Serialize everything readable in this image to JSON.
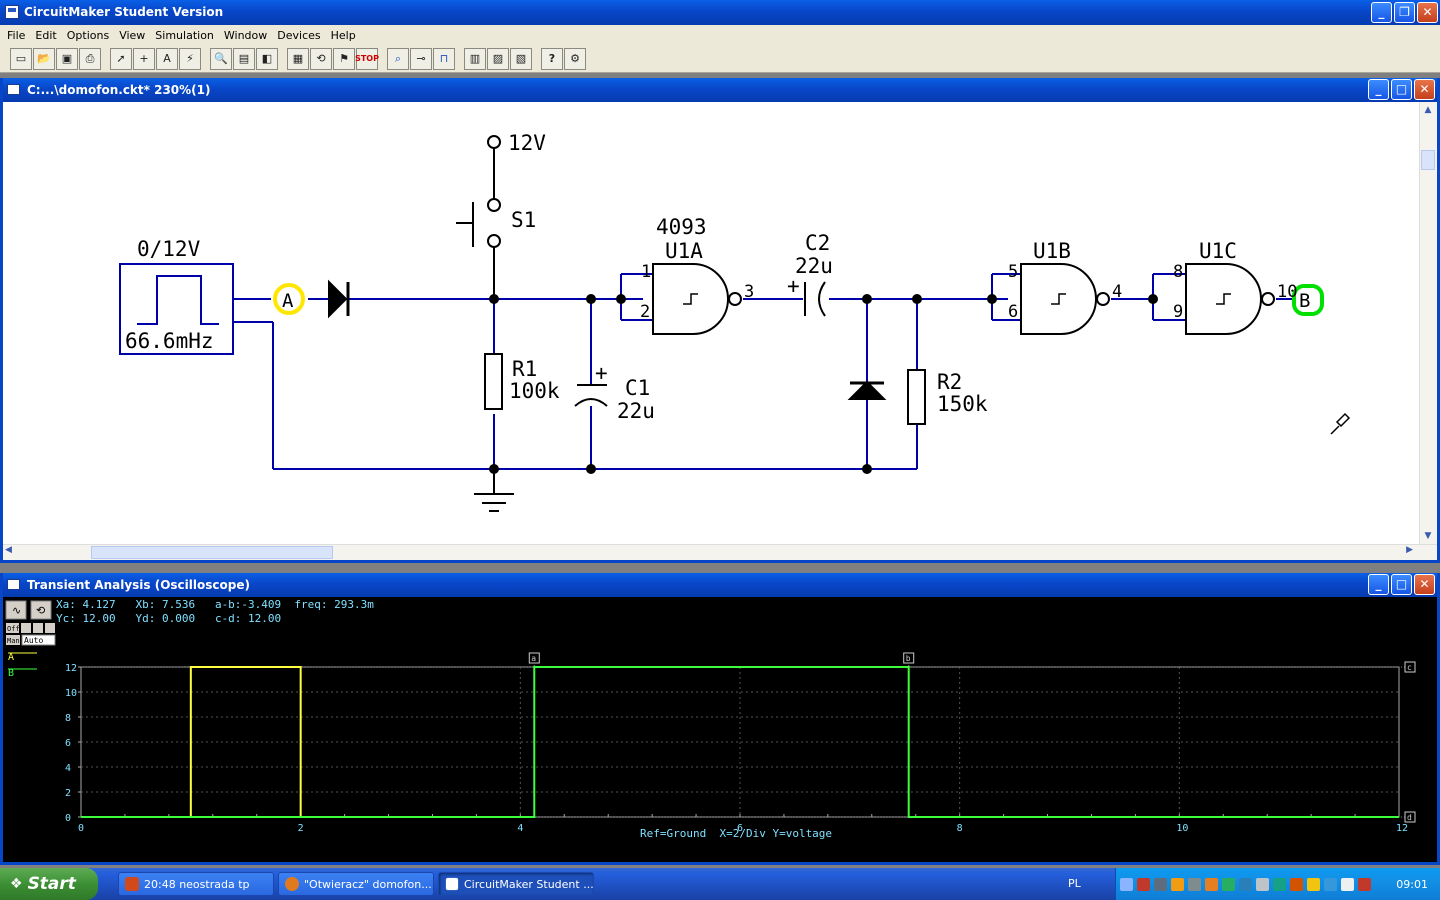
{
  "app": {
    "title": "CircuitMaker Student Version"
  },
  "menu": [
    "File",
    "Edit",
    "Options",
    "View",
    "Simulation",
    "Window",
    "Devices",
    "Help"
  ],
  "schematic_window": {
    "title": "C:...\\domofon.ckt* 230%(1)",
    "labels": {
      "supply": "12V",
      "switch": "S1",
      "source_top": "0/12V",
      "source_freq": "66.6mHz",
      "probe_a": "A",
      "probe_b": "B",
      "r1_name": "R1",
      "r1_val": "100k",
      "c1_plus": "+",
      "c1_name": "C1",
      "c1_val": "22u",
      "ic_type": "4093",
      "u1a": "U1A",
      "u1b": "U1B",
      "u1c": "U1C",
      "c2_name": "C2",
      "c2_val": "22u",
      "c2_plus": "+",
      "r2_name": "R2",
      "r2_val": "150k",
      "pin1": "1",
      "pin2": "2",
      "pin3": "3",
      "pin4": "4",
      "pin5": "5",
      "pin6": "6",
      "pin8": "8",
      "pin9": "9",
      "pin10": "10"
    }
  },
  "scope_window": {
    "title": "Transient Analysis (Oscilloscope)",
    "readouts": {
      "line1": "Xa: 4.127   Xb: 7.536   a-b:-3.409  freq: 293.3m",
      "line2": "Yc: 12.00   Yd: 0.000   c-d: 12.00"
    },
    "side": {
      "off": "Off",
      "man": "Man",
      "auto": "Auto"
    },
    "footer": "Ref=Ground  X=2/Div Y=voltage",
    "cursor_labels": {
      "a": "a",
      "b": "b",
      "c": "c",
      "d": "d"
    }
  },
  "chart_data": {
    "type": "line",
    "xlabel": "Ref=Ground  X=2/Div Y=voltage",
    "xlim": [
      0,
      12
    ],
    "ylim": [
      0,
      12
    ],
    "xticks": [
      0,
      2,
      4,
      6,
      8,
      10,
      12
    ],
    "yticks": [
      0,
      2,
      4,
      6,
      8,
      10,
      12
    ],
    "cursors": {
      "a": 4.127,
      "b": 7.536,
      "c": 12.0,
      "d": 0.0
    },
    "series": [
      {
        "name": "A",
        "color": "#ffff40",
        "points": [
          [
            0,
            0
          ],
          [
            1,
            0
          ],
          [
            1,
            12
          ],
          [
            2,
            12
          ],
          [
            2,
            0
          ],
          [
            4.127,
            0
          ]
        ]
      },
      {
        "name": "B",
        "color": "#3cff3c",
        "points": [
          [
            0,
            0
          ],
          [
            4.127,
            0
          ],
          [
            4.127,
            12
          ],
          [
            7.536,
            12
          ],
          [
            7.536,
            0
          ],
          [
            12,
            0
          ]
        ]
      }
    ]
  },
  "taskbar": {
    "start": "Start",
    "buttons": [
      {
        "label": "20:48 neostrada tp",
        "color": "#d24a1c"
      },
      {
        "label": "\"Otwieracz\" domofon...",
        "color": "#e07a1e"
      },
      {
        "label": "CircuitMaker Student ...",
        "color": "#3060c0"
      }
    ],
    "lang": "PL",
    "clock": "09:01"
  }
}
